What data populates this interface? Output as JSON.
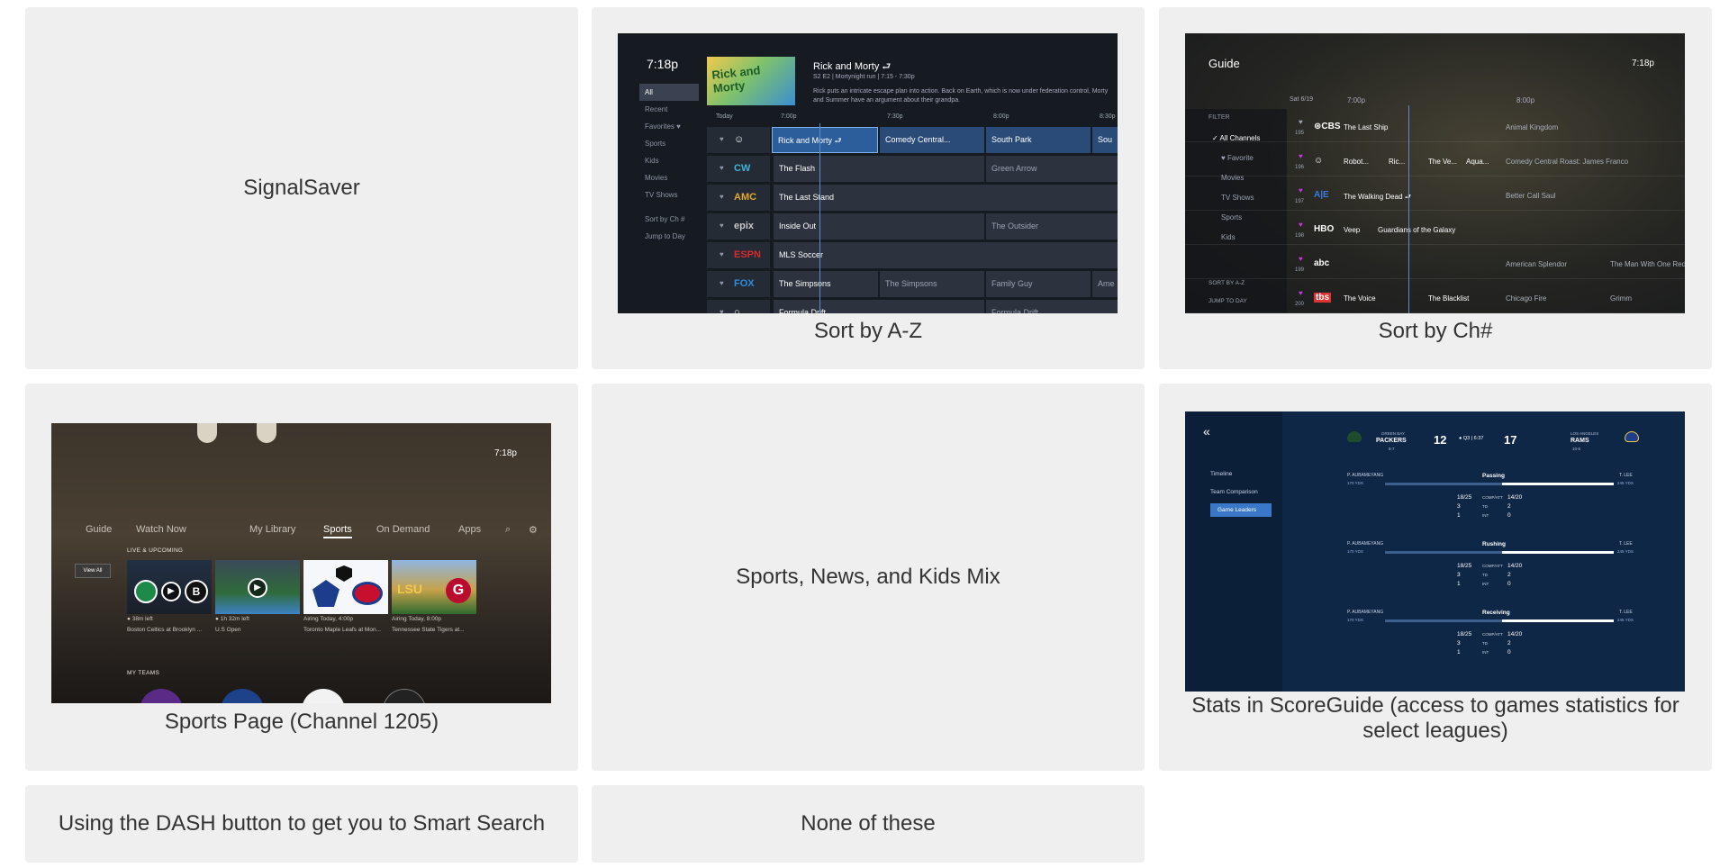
{
  "cards": [
    {
      "id": "signalsaver",
      "caption": "SignalSaver"
    },
    {
      "id": "sort-az",
      "caption": "Sort by A-Z"
    },
    {
      "id": "sort-ch",
      "caption": "Sort by Ch#"
    },
    {
      "id": "sports-page",
      "caption": "Sports Page (Channel 1205)"
    },
    {
      "id": "sports-mix",
      "caption": "Sports, News, and Kids Mix"
    },
    {
      "id": "scoreguide",
      "caption": "Stats in ScoreGuide (access to games statistics for select leagues)"
    },
    {
      "id": "dash",
      "caption": "Using the DASH button to get you to Smart Search"
    },
    {
      "id": "none",
      "caption": "None of these"
    }
  ],
  "guide_az": {
    "time": "7:18p",
    "show_title": "Rick and Morty ⮐",
    "show_sub": "S2 E2 | Mortynight run | 7:15 - 7:30p",
    "show_desc": "Rick puts an intricate escape plan into action. Back on Earth, which is now under federation control, Morty and Summer have an argument about their grandpa.",
    "poster_text": "Rick and Morty",
    "side": [
      "All",
      "Recent",
      "Favorites ♥",
      "Sports",
      "Kids",
      "Movies",
      "TV Shows",
      "Sort by Ch #",
      "Jump to Day"
    ],
    "times": [
      "Today",
      "7:00p",
      "7:30p",
      "8:00p",
      "8:30p"
    ],
    "rows": [
      {
        "logo": "☺",
        "logo_color": "#ffffff",
        "progs": [
          "Rick and Morty ⮐",
          "Comedy Central...",
          "South Park",
          "Sou"
        ]
      },
      {
        "logo": "CW",
        "logo_color": "#3fb4d6",
        "progs": [
          "The Flash",
          "Green Arrow"
        ]
      },
      {
        "logo": "AMC",
        "logo_color": "#e0a92c",
        "progs": [
          "The Last Stand"
        ]
      },
      {
        "logo": "epix",
        "logo_color": "#c8c8c8",
        "progs": [
          "Inside Out",
          "The Outsider"
        ]
      },
      {
        "logo": "ESPN",
        "logo_color": "#d62b2b",
        "progs": [
          "MLS Soccer"
        ]
      },
      {
        "logo": "FOX",
        "logo_color": "#2e8de0",
        "progs": [
          "The Simpsons",
          "The Simpsons",
          "Family Guy",
          "Ame"
        ]
      },
      {
        "logo": "○",
        "logo_color": "#ffffff",
        "progs": [
          "Formula Drift",
          "Formula Drift"
        ]
      }
    ]
  },
  "guide_ch": {
    "title": "Guide",
    "clock": "7:18p",
    "date": "Sat 6/19",
    "times": [
      "7:00p",
      "8:00p"
    ],
    "filter_label": "FILTER",
    "filters": [
      "✓ All Channels",
      "♥ Favorite",
      "Movies",
      "TV Shows",
      "Sports",
      "Kids"
    ],
    "sort_label": "SORT BY A-Z",
    "jump_label": "JUMP TO DAY",
    "rows": [
      {
        "num": "195",
        "logo": "⊛CBS",
        "cells": [
          "The Last Ship",
          "Animal Kingdom"
        ]
      },
      {
        "num": "196",
        "logo": "☺",
        "cells": [
          "Robot...",
          "Ric...",
          "The Ve...",
          "Aqua...",
          "Comedy Central Roast: James Franco"
        ]
      },
      {
        "num": "197",
        "logo": "A|E",
        "cells": [
          "The Walking Dead ⮐",
          "Better Call Saul"
        ]
      },
      {
        "num": "198",
        "logo": "HBO",
        "cells": [
          "Veep",
          "Guardians of the Galaxy"
        ]
      },
      {
        "num": "199",
        "logo": "abc",
        "cells": [
          "American Splendor",
          "The Man With One Red"
        ]
      },
      {
        "num": "200",
        "logo": "tbs",
        "cells": [
          "The Voice",
          "The Blacklist",
          "Chicago Fire",
          "Grimm"
        ]
      }
    ]
  },
  "sports": {
    "clock": "7:18p",
    "nav": [
      "Guide",
      "Watch Now",
      "My Library",
      "Sports",
      "On Demand",
      "Apps"
    ],
    "live_label": "LIVE & UPCOMING",
    "view_all": "View All",
    "my_teams": "MY TEAMS",
    "tiles": [
      {
        "status": "● 38m left",
        "title": "Boston Celtics at Brooklyn ..."
      },
      {
        "status": "● 1h 32m left",
        "title": "U.S Open"
      },
      {
        "status": "Airing   Today, 4:00p",
        "title": "Toronto Maple Leafs at Mon..."
      },
      {
        "status": "Airing   Today, 8:00p",
        "title": "Tennessee State Tigers at..."
      }
    ]
  },
  "scoreguide": {
    "menu": [
      "Timeline",
      "Team Comparison",
      "Game Leaders"
    ],
    "home": {
      "city": "GREEN BAY",
      "name": "PACKERS",
      "record": "8-7",
      "score": "12"
    },
    "away": {
      "city": "LOS ANGELES",
      "name": "RAMS",
      "record": "10-5",
      "score": "17"
    },
    "clock": "● Q3 | 6:37",
    "sections": [
      {
        "cat": "Passing",
        "left_player": "P. AUBAMEYANG",
        "left_yds": "170 YDS",
        "right_player": "T. LEE",
        "right_yds": "245 YDS",
        "rows": [
          [
            "18/25",
            "COMP/ATT",
            "14/20"
          ],
          [
            "3",
            "TD",
            "2"
          ],
          [
            "1",
            "INT",
            "0"
          ]
        ]
      },
      {
        "cat": "Rushing",
        "left_player": "P. AUBAMEYANG",
        "left_yds": "170 YDS",
        "right_player": "T. LEE",
        "right_yds": "245 YDS",
        "rows": [
          [
            "18/25",
            "COMP/ATT",
            "14/20"
          ],
          [
            "3",
            "TD",
            "2"
          ],
          [
            "1",
            "INT",
            "0"
          ]
        ]
      },
      {
        "cat": "Receiving",
        "left_player": "P. AUBAMEYANG",
        "left_yds": "170 YDS",
        "right_player": "T. LEE",
        "right_yds": "245 YDS",
        "rows": [
          [
            "18/25",
            "COMP/ATT",
            "14/20"
          ],
          [
            "3",
            "TD",
            "2"
          ],
          [
            "1",
            "INT",
            "0"
          ]
        ]
      }
    ]
  }
}
